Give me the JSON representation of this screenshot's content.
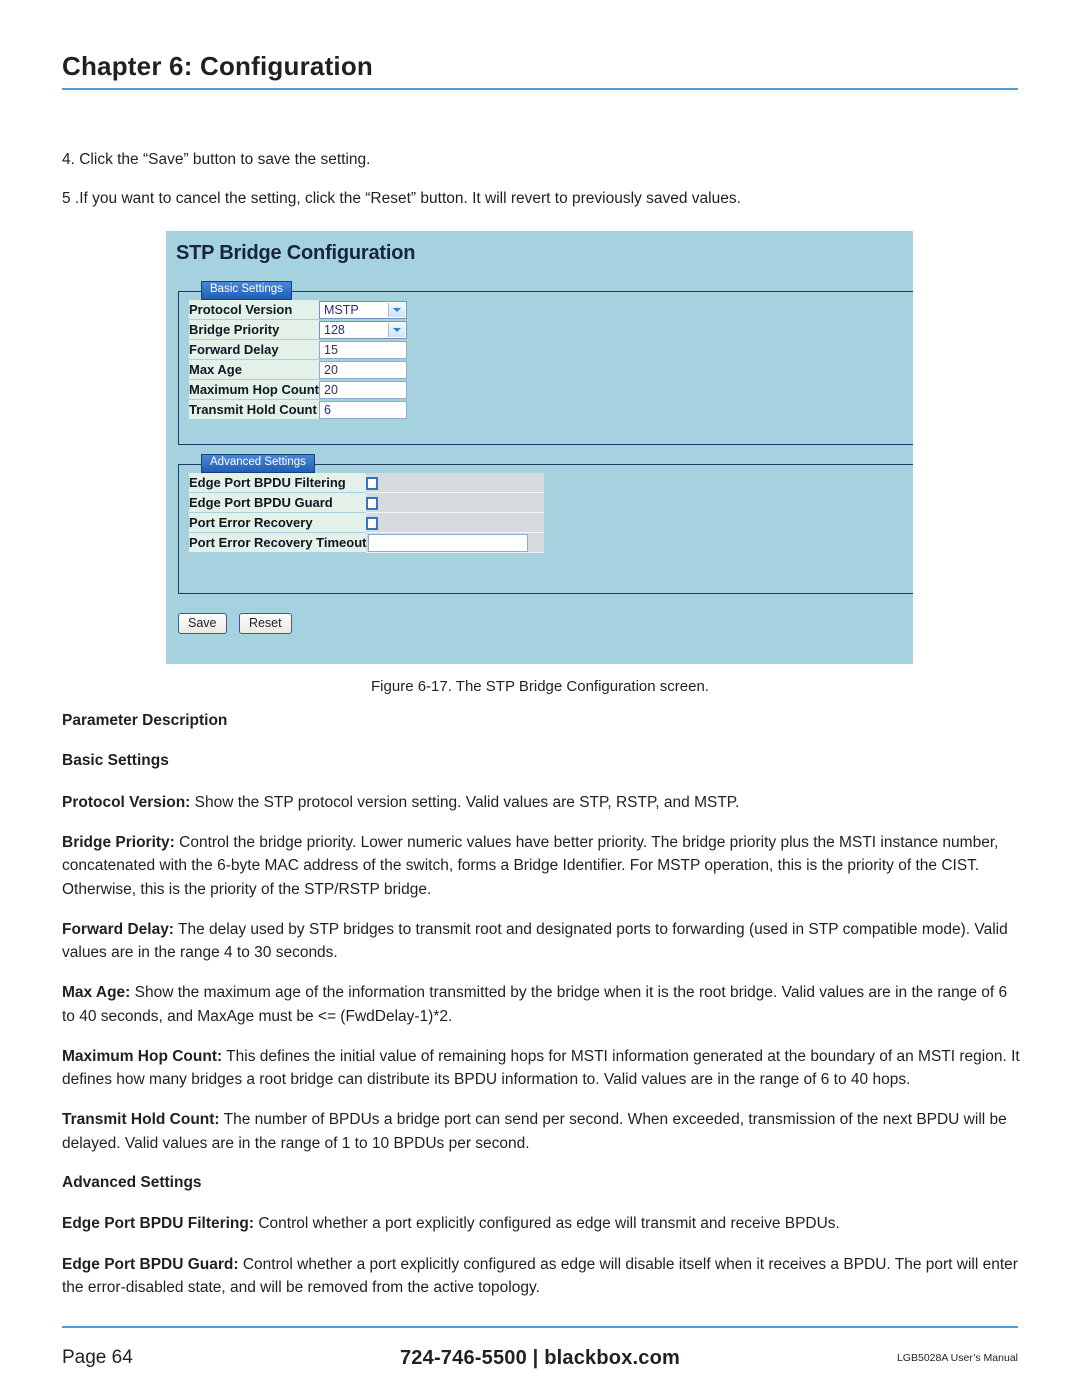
{
  "header": {
    "chapter_title": "Chapter 6: Configuration",
    "rule_color": "#4d9fd4"
  },
  "steps": [
    "4. Click the “Save” button to save the setting.",
    "5 .If you want to cancel the setting, click the “Reset” button. It will revert to previously saved values."
  ],
  "screenshot": {
    "title": "STP Bridge Configuration",
    "background_color": "#a6d2e0",
    "basic_settings": {
      "legend": "Basic Settings",
      "rows": [
        {
          "label": "Protocol Version",
          "control": "select",
          "value": "MSTP"
        },
        {
          "label": "Bridge Priority",
          "control": "select",
          "value": "128"
        },
        {
          "label": "Forward Delay",
          "control": "text",
          "value": "15"
        },
        {
          "label": "Max Age",
          "control": "text",
          "value": "20"
        },
        {
          "label": "Maximum Hop Count",
          "control": "text",
          "value": "20"
        },
        {
          "label": "Transmit Hold Count",
          "control": "text",
          "value": "6"
        }
      ]
    },
    "advanced_settings": {
      "legend": "Advanced Settings",
      "rows": [
        {
          "label": "Edge Port BPDU Filtering",
          "control": "checkbox",
          "checked": false
        },
        {
          "label": "Edge Port BPDU Guard",
          "control": "checkbox",
          "checked": false
        },
        {
          "label": "Port Error Recovery",
          "control": "checkbox",
          "checked": false
        },
        {
          "label": "Port Error Recovery Timeout",
          "control": "text",
          "value": ""
        }
      ]
    },
    "buttons": {
      "save": "Save",
      "reset": "Reset"
    }
  },
  "figure_caption": "Figure 6-17. The STP Bridge Configuration screen.",
  "body": {
    "parameter_description_heading": "Parameter Description",
    "basic_settings_heading": "Basic Settings",
    "advanced_settings_heading": "Advanced Settings",
    "paragraphs": {
      "protocol_version": {
        "term": "Protocol Version:",
        "text": " Show the STP protocol version setting. Valid values are STP, RSTP, and MSTP."
      },
      "bridge_priority": {
        "term": "Bridge Priority:",
        "text": " Control the bridge priority. Lower numeric values have better priority. The bridge priority plus the MSTI instance number, concatenated with the 6-byte MAC address of the switch, forms a Bridge Identifier. For MSTP operation, this is the priority of the CIST. Otherwise, this is the priority of the STP/RSTP bridge."
      },
      "forward_delay": {
        "term": "Forward Delay:",
        "text": " The delay used by STP bridges to transmit root and designated ports to forwarding (used in STP compatible mode). Valid values are in the range 4 to 30 seconds."
      },
      "max_age": {
        "term": "Max Age:",
        "text": " Show the maximum age of the information transmitted by the bridge when it is the root bridge. Valid values are in the range of 6 to 40 seconds, and MaxAge must be <= (FwdDelay-1)*2."
      },
      "maximum_hop_count": {
        "term": "Maximum Hop Count:",
        "text": " This defines the initial value of remaining hops for MSTI information generated at the boundary of an MSTI region. It defines how many bridges a root bridge can distribute its BPDU information to. Valid values are in the range of 6 to 40 hops."
      },
      "transmit_hold_count": {
        "term": "Transmit Hold Count:",
        "text": " The number of BPDUs a bridge port can send per second. When exceeded, transmission of the next BPDU will be delayed. Valid values are in the range of 1 to 10 BPDUs per second."
      },
      "edge_port_bpdu_filtering": {
        "term": "Edge Port BPDU Filtering:",
        "text": " Control whether a port explicitly configured as edge will transmit and receive BPDUs."
      },
      "edge_port_bpdu_guard": {
        "term": "Edge Port BPDU Guard:",
        "text": " Control whether a port explicitly configured as edge will disable itself when it receives a BPDU. The port will enter the error-disabled state, and will be removed from the active topology."
      }
    }
  },
  "footer": {
    "page_label": "Page 64",
    "contact": "724-746-5500  |  blackbox.com",
    "manual": "LGB5028A User’s Manual"
  }
}
